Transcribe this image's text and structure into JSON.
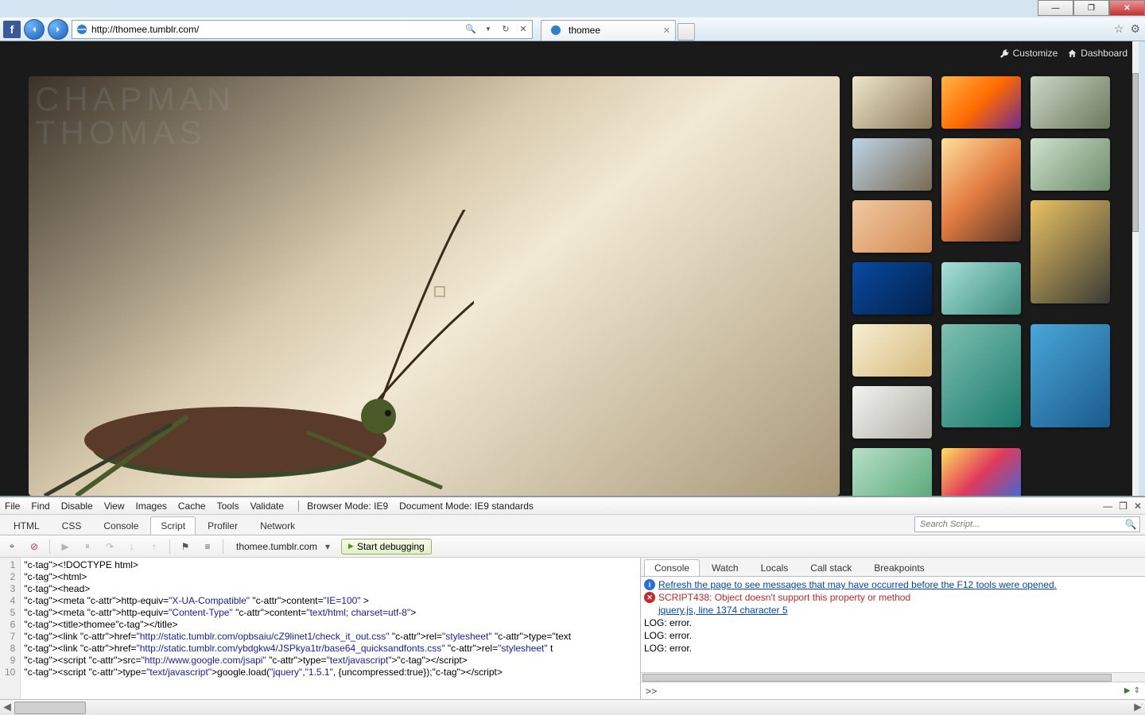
{
  "window": {
    "min": "—",
    "max": "❐",
    "close": "✕"
  },
  "browser": {
    "url": "http://thomee.tumblr.com/",
    "search_icon": "🔍",
    "refresh_icon": "↻",
    "stop_icon": "✕",
    "tab_title": "thomee",
    "star_icon": "☆",
    "gear_icon": "⚙"
  },
  "tumblr": {
    "customize": "Customize",
    "dashboard": "Dashboard",
    "watermark1": "CHAPMAN",
    "watermark2": "THOMAS"
  },
  "thumbs": [
    {
      "bg": "linear-gradient(135deg,#efe6cc,#8c7b5a)",
      "tall": false
    },
    {
      "bg": "linear-gradient(135deg,#ffb347,#ff6a00,#6b2c91)",
      "tall": false
    },
    {
      "bg": "linear-gradient(135deg,#cdd6c8,#6a7a5c)",
      "tall": false
    },
    {
      "bg": "linear-gradient(135deg,#bcd4e6,#7a6a52)",
      "tall": false
    },
    {
      "bg": "linear-gradient(135deg,#ffdf9e,#e07a3f,#5a3a2a)",
      "tall": true
    },
    {
      "bg": "linear-gradient(135deg,#cfe0cc,#6e8c6c)",
      "tall": false
    },
    {
      "bg": "linear-gradient(135deg,#f2c9a0,#d18a52)",
      "tall": false
    },
    {
      "bg": "linear-gradient(135deg,#e9c263,#3a3a34)",
      "tall": true
    },
    {
      "bg": "linear-gradient(135deg,#0a4aa0,#02204a)",
      "tall": false
    },
    {
      "bg": "linear-gradient(135deg,#a8e0d8,#3a8a7c)",
      "tall": false
    },
    {
      "bg": "linear-gradient(135deg,#f7efd2,#d6b97c)",
      "tall": false
    },
    {
      "bg": "linear-gradient(135deg,#7ec0b2,#1a7a6c)",
      "tall": true
    },
    {
      "bg": "linear-gradient(135deg,#4aa6d8,#1a5a8c)",
      "tall": true
    },
    {
      "bg": "linear-gradient(135deg,#f2f2f0,#b0b0a8)",
      "tall": false
    },
    {
      "bg": "linear-gradient(135deg,#b8e0c8,#58a878)",
      "tall": false
    },
    {
      "bg": "linear-gradient(135deg,#ffe05a,#e03a5a,#3a6ad8)",
      "tall": false
    }
  ],
  "devmenu": {
    "file": "File",
    "find": "Find",
    "disable": "Disable",
    "view": "View",
    "images": "Images",
    "cache": "Cache",
    "tools": "Tools",
    "validate": "Validate",
    "bm_label": "Browser Mode:",
    "bm_val": "IE9",
    "dm_label": "Document Mode:",
    "dm_val": "IE9 standards"
  },
  "devtabs": {
    "html": "HTML",
    "css": "CSS",
    "console": "Console",
    "script": "Script",
    "profiler": "Profiler",
    "network": "Network"
  },
  "search_placeholder": "Search Script...",
  "toolbar": {
    "source": "thomee.tumblr.com",
    "debug": "Start debugging"
  },
  "code_lines": [
    "<!DOCTYPE html>",
    "<html>",
    "<head>",
    "<meta http-equiv=\"X-UA-Compatible\" content=\"IE=100\" >",
    "<meta http-equiv=\"Content-Type\" content=\"text/html; charset=utf-8\">",
    "<title>thomee</title>",
    "<link href=\"http://static.tumblr.com/opbsaiu/cZ9linet1/check_it_out.css\" rel=\"stylesheet\" type=\"text",
    "<link href=\"http://static.tumblr.com/ybdgkw4/JSPkya1tr/base64_quicksandfonts.css\" rel=\"stylesheet\" t",
    "<script src=\"http://www.google.com/jsapi\" type=\"text/javascript\"></script>",
    "<script type=\"text/javascript\">google.load(\"jquery\",\"1.5.1\", {uncompressed:true});</script>"
  ],
  "rptabs": {
    "console": "Console",
    "watch": "Watch",
    "locals": "Locals",
    "callstack": "Call stack",
    "breakpoints": "Breakpoints"
  },
  "console": {
    "info": "Refresh the page to see messages that may have occurred before the F12 tools were opened.",
    "err": "SCRIPT438: Object doesn't support this property or method",
    "err_src": "jquery.js, line 1374 character 5",
    "log1": "LOG: error.",
    "log2": "LOG: error.",
    "log3": "LOG: error.",
    "prompt": ">>"
  }
}
